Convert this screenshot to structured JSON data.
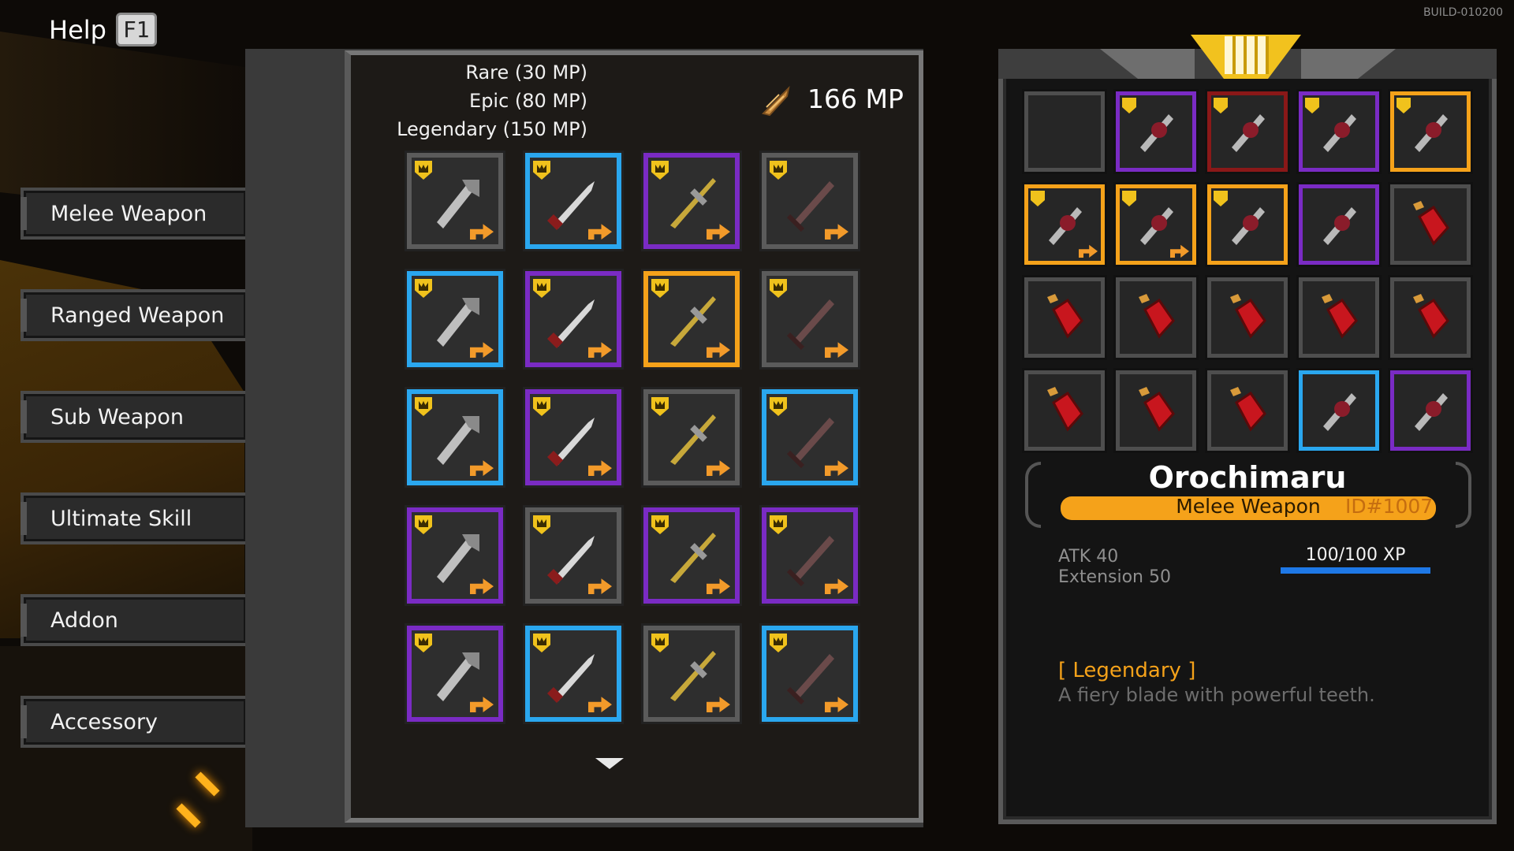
{
  "help": {
    "label": "Help",
    "key": "F1"
  },
  "build": "BUILD-010200",
  "categories": [
    {
      "label": "Melee Weapon"
    },
    {
      "label": "Ranged Weapon"
    },
    {
      "label": "Sub Weapon"
    },
    {
      "label": "Ultimate Skill"
    },
    {
      "label": "Addon"
    },
    {
      "label": "Accessory"
    }
  ],
  "rarity_costs": [
    "Rare (30 MP)",
    "Epic (80 MP)",
    "Legendary (150 MP)"
  ],
  "mp_balance": "166 MP",
  "item_grid": [
    [
      "gray",
      "blue",
      "purple",
      "gray"
    ],
    [
      "blue",
      "purple",
      "gold",
      "gray"
    ],
    [
      "blue",
      "purple",
      "gray",
      "blue"
    ],
    [
      "purple",
      "gray",
      "purple",
      "purple"
    ],
    [
      "purple",
      "blue",
      "gray",
      "blue"
    ]
  ],
  "inventory": [
    [
      "empty",
      "purple",
      "red",
      "purple",
      "gold"
    ],
    [
      "gold",
      "gold",
      "gold",
      "purple",
      "gray"
    ],
    [
      "gray",
      "gray",
      "gray",
      "gray",
      "gray"
    ],
    [
      "gray",
      "gray",
      "gray",
      "blue",
      "purple"
    ]
  ],
  "selected_item": {
    "name": "Orochimaru",
    "type": "Melee Weapon",
    "id": "ID#1007",
    "stats": [
      "ATK 40",
      "Extension 50"
    ],
    "xp_label": "100/100 XP",
    "xp_fraction": 1.0,
    "rarity": "[ Legendary ]",
    "description": "A fiery blade with powerful teeth."
  },
  "colors": {
    "rare": "#2aa7ef",
    "epic": "#7a2bc4",
    "legendary": "#f5a21a",
    "common": "#5b5b5b"
  }
}
